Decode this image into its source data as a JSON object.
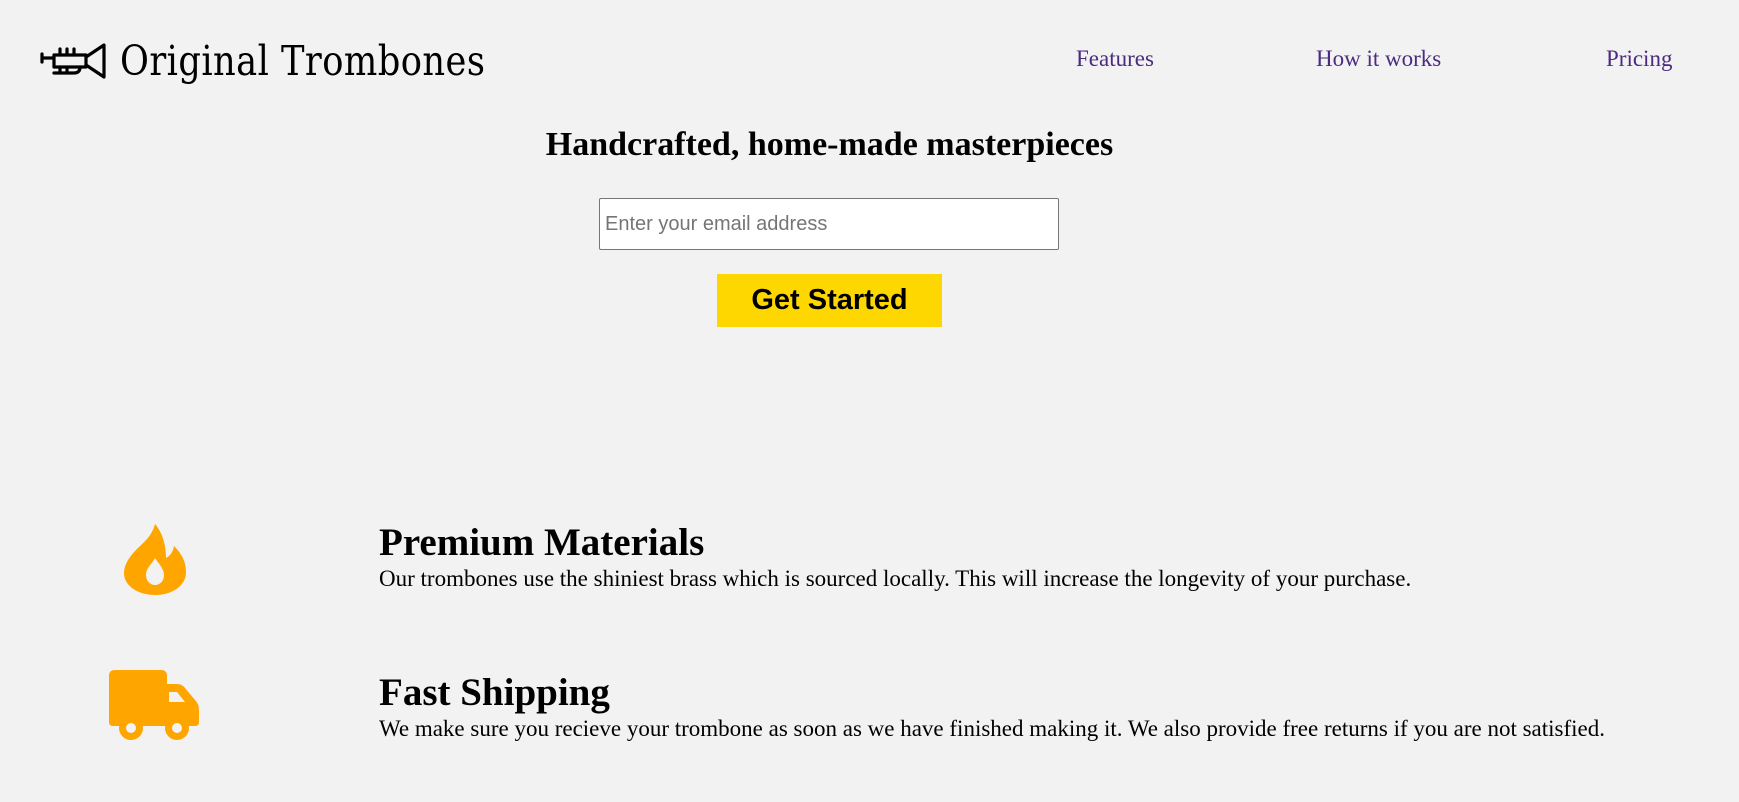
{
  "brand": {
    "name": "Original Trombones",
    "logo_icon": "trombone-icon"
  },
  "nav": {
    "items": [
      {
        "label": "Features"
      },
      {
        "label": "How it works"
      },
      {
        "label": "Pricing"
      }
    ]
  },
  "hero": {
    "title": "Handcrafted, home-made masterpieces",
    "email_placeholder": "Enter your email address",
    "button_label": "Get Started"
  },
  "features": [
    {
      "icon": "fire-icon",
      "title": "Premium Materials",
      "description": "Our trombones use the shiniest brass which is sourced locally. This will increase the longevity of your purchase."
    },
    {
      "icon": "truck-icon",
      "title": "Fast Shipping",
      "description": "We make sure you recieve your trombone as soon as we have finished making it. We also provide free returns if you are not satisfied."
    }
  ],
  "colors": {
    "background": "#f2f2f2",
    "accent": "#ffa500",
    "button": "#ffd700",
    "nav_link": "#4b2a80"
  }
}
